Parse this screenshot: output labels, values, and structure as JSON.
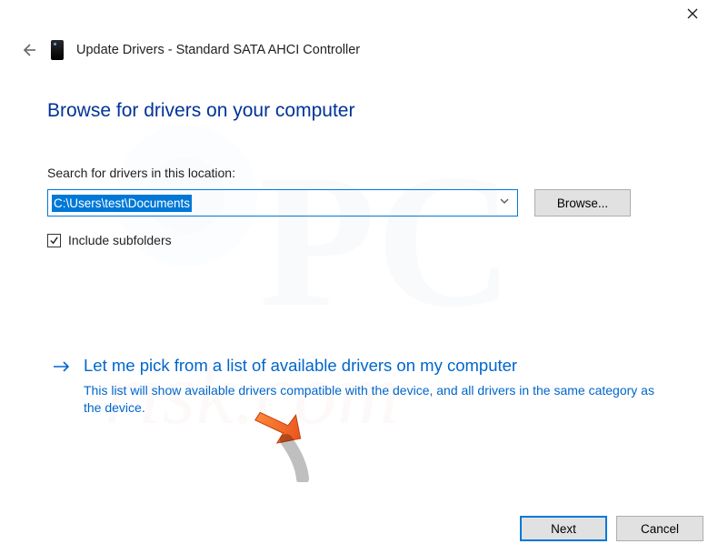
{
  "title": "Update Drivers - Standard SATA AHCI Controller",
  "heading": "Browse for drivers on your computer",
  "search_label": "Search for drivers in this location:",
  "path_value": "C:\\Users\\test\\Documents",
  "browse_label": "Browse...",
  "include_subfolders_label": "Include subfolders",
  "include_subfolders_checked": true,
  "pick_title": "Let me pick from a list of available drivers on my computer",
  "pick_desc": "This list will show available drivers compatible with the device, and all drivers in the same category as the device.",
  "next_label": "Next",
  "cancel_label": "Cancel"
}
